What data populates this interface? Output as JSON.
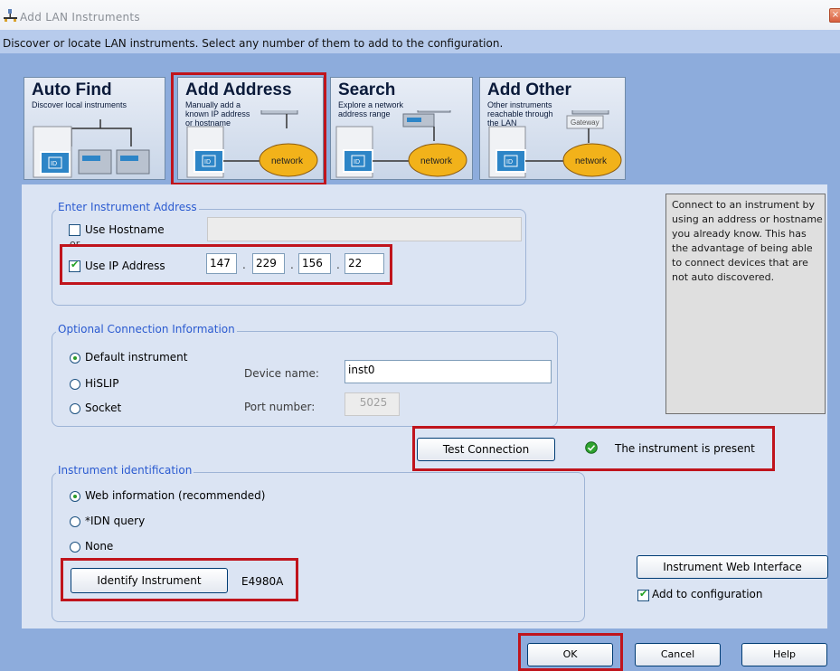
{
  "window": {
    "title": "Add LAN Instruments",
    "close_glyph": "×",
    "intro": "Discover or locate LAN instruments. Select any number of them to add to the configuration."
  },
  "modes": [
    {
      "title": "Auto Find",
      "desc": "Discover local instruments"
    },
    {
      "title": "Add Address",
      "desc": "Manually add a\nknown IP address\nor hostname"
    },
    {
      "title": "Search",
      "desc": "Explore a network\naddress range"
    },
    {
      "title": "Add Other",
      "desc": "Other instruments\nreachable through\nthe LAN"
    }
  ],
  "graphic_labels": {
    "network": "network",
    "gateway": "Gateway",
    "id": "ID"
  },
  "address_group": {
    "label": "Enter Instrument Address",
    "hostname_label": "Use Hostname",
    "hostname_checked": false,
    "hostname_value": "",
    "or_text": "or",
    "ip_label": "Use IP Address",
    "ip_checked": true,
    "ip": [
      "147",
      "229",
      "156",
      "22"
    ]
  },
  "optional_group": {
    "label": "Optional Connection Information",
    "options": [
      "Default instrument",
      "HiSLIP",
      "Socket"
    ],
    "selected": "Default instrument",
    "device_name_label": "Device name:",
    "device_name_value": "inst0",
    "port_label": "Port number:",
    "port_value": "5025"
  },
  "test": {
    "button": "Test Connection",
    "status": "The instrument is present"
  },
  "identification_group": {
    "label": "Instrument identification",
    "options": [
      "Web information (recommended)",
      "*IDN query",
      "None"
    ],
    "selected": "Web information (recommended)",
    "identify_button": "Identify Instrument",
    "model": "E4980A"
  },
  "help_text": "Connect to an instrument by using an address or hostname you already know. This has the advantage of being able to connect devices that are not auto discovered.",
  "web_interface_button": "Instrument Web Interface",
  "add_to_config_label": "Add to configuration",
  "add_to_config_checked": true,
  "footer": {
    "ok": "OK",
    "cancel": "Cancel",
    "help": "Help"
  },
  "colors": {
    "window_bg": "#8dacdc",
    "content_bg": "#dbe4f3",
    "group_label": "#2a5ad0",
    "highlight": "#c0141c",
    "status_ok": "#2fa32f"
  }
}
